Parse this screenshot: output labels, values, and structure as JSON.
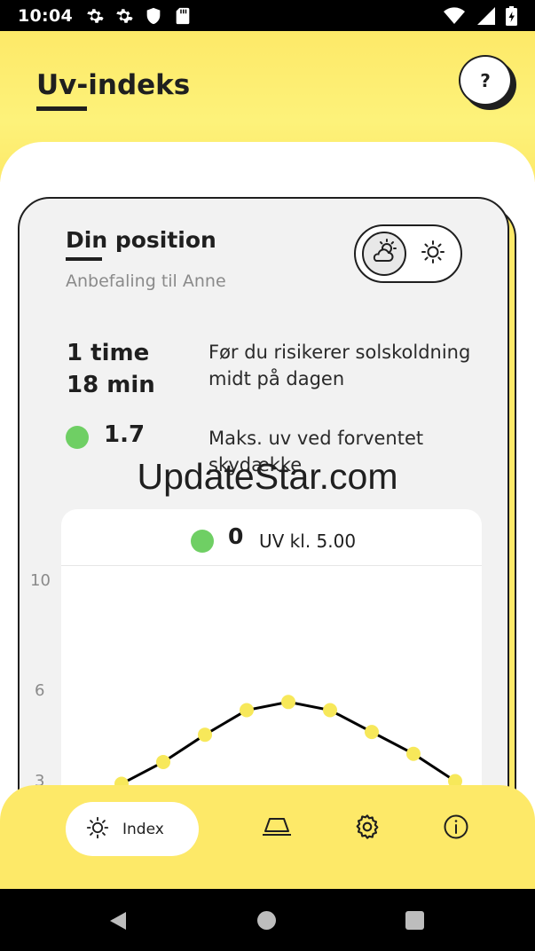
{
  "status_bar": {
    "time": "10:04",
    "icons": [
      "gear-icon",
      "gear-icon",
      "shield-icon",
      "sd-card-icon",
      "wifi-icon",
      "cellular-icon",
      "battery-icon"
    ]
  },
  "header": {
    "title": "Uv-indeks",
    "help_label": "?"
  },
  "card": {
    "heading": "Din position",
    "subtitle": "Anbefaling til Anne",
    "toggle": {
      "left_icon": "cloud-sun-icon",
      "right_icon": "sun-icon",
      "selected": "left"
    },
    "burn_time_line1": "1 time",
    "burn_time_line2": "18 min",
    "burn_desc_line1": "Før du risikerer solskoldning",
    "burn_desc_line2": "midt på dagen",
    "max_uv_value": "1.7",
    "max_uv_desc_line1": "Maks. uv ved forventet",
    "max_uv_desc_line2": "skydække",
    "status_color": "#6fcf64"
  },
  "chart_head": {
    "value": "0",
    "label": "UV kl. 5.00"
  },
  "chart_data": {
    "type": "line",
    "ytick_labels": [
      "10",
      "6",
      "3"
    ],
    "ylim": [
      0,
      10
    ],
    "series": [
      {
        "values": [
          2.6,
          3.4,
          4.4,
          5.3,
          5.6,
          5.3,
          4.5,
          3.7,
          2.7
        ]
      }
    ],
    "point_color": "#f7e85a",
    "line_color": "#000000"
  },
  "watermark": "UpdateStar.com",
  "bottom_nav": {
    "index_label": "Index",
    "items": [
      "sun-icon",
      "lamp-icon",
      "gear-icon",
      "info-icon"
    ]
  },
  "colors": {
    "brand_yellow": "#fde968",
    "card_bg": "#f2f2f2"
  }
}
